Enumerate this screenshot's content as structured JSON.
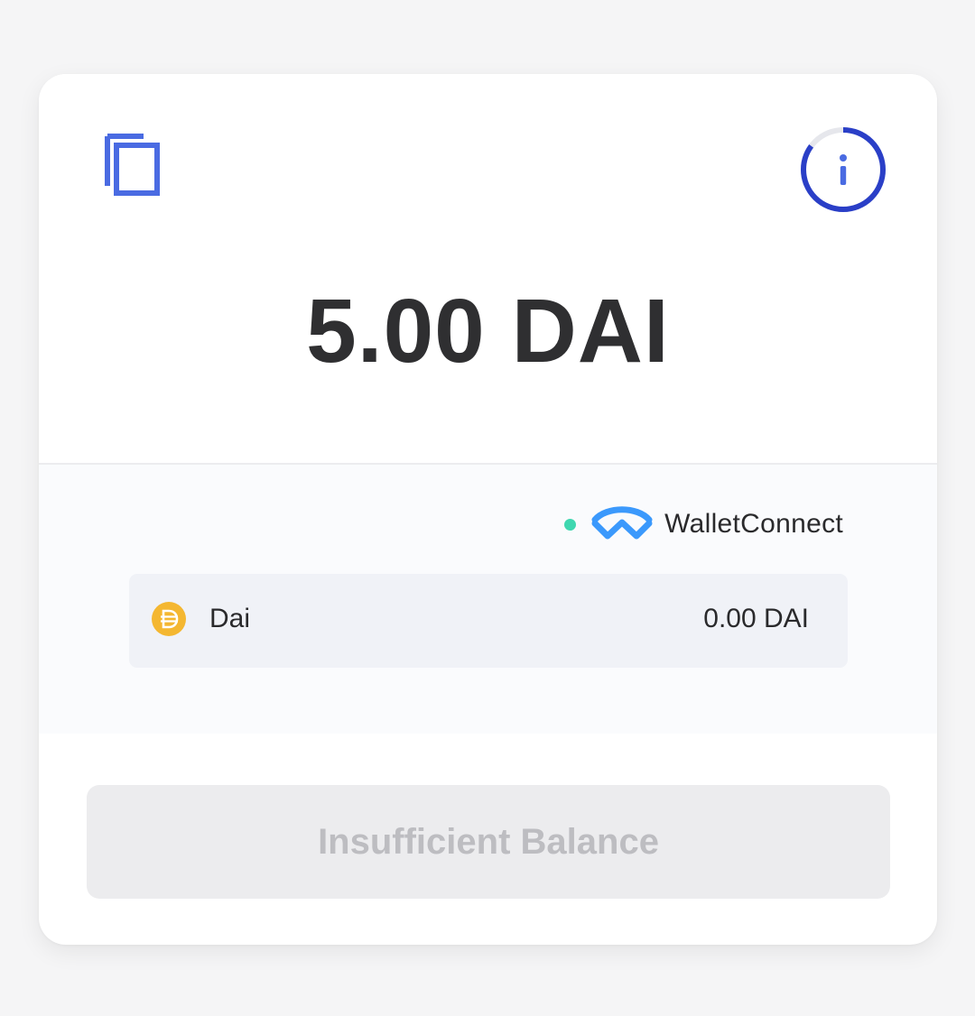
{
  "payment": {
    "amount": "5.00 DAI"
  },
  "header": {
    "copy_icon": "copy-icon",
    "info_icon": "info-icon",
    "timer_progress": 0.85
  },
  "provider": {
    "status": "connected",
    "status_color": "#3fd7b0",
    "logo_icon": "walletconnect-logo-icon",
    "name": "WalletConnect"
  },
  "token": {
    "icon": "dai-icon",
    "icon_color": "#f4b731",
    "name": "Dai",
    "balance": "0.00 DAI"
  },
  "action": {
    "label": "Insufficient Balance",
    "disabled": true
  },
  "colors": {
    "accent": "#3157d8",
    "timer_ring": "#2a3fc7",
    "walletconnect_blue": "#3b99fc"
  }
}
